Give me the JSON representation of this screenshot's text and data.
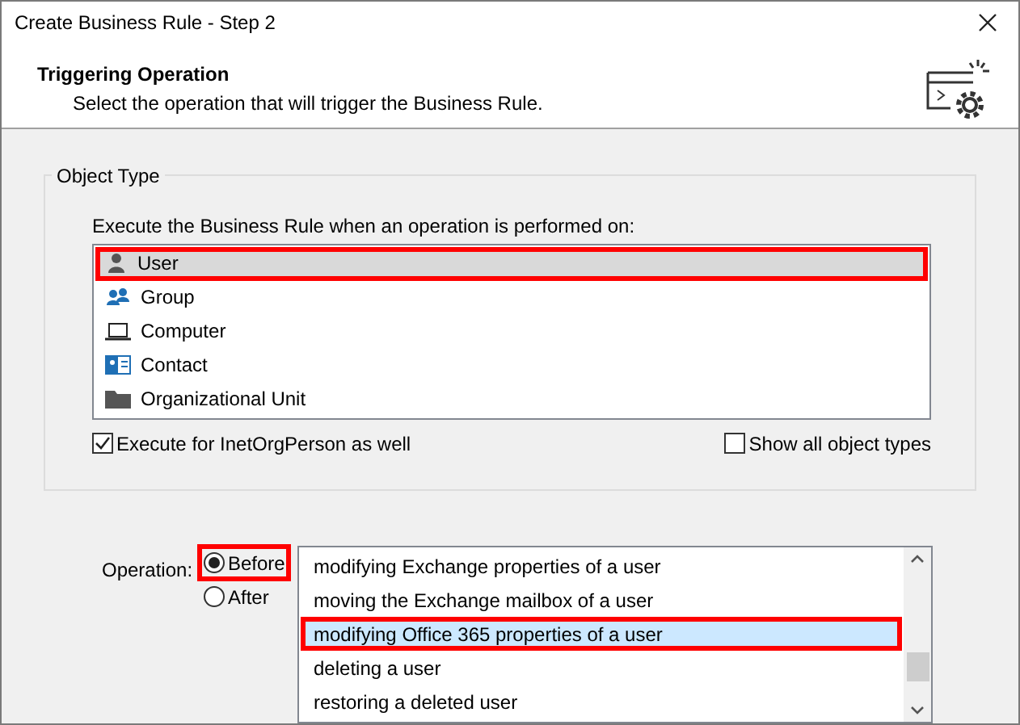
{
  "window": {
    "title": "Create Business Rule - Step 2"
  },
  "header": {
    "title": "Triggering Operation",
    "subtitle": "Select the operation that will trigger the Business Rule."
  },
  "object_type": {
    "group_title": "Object Type",
    "prompt": "Execute the Business Rule when an operation is performed on:",
    "items": [
      {
        "kind": "user",
        "label": "User",
        "selected": true,
        "highlighted": true
      },
      {
        "kind": "group",
        "label": "Group",
        "selected": false,
        "highlighted": false
      },
      {
        "kind": "computer",
        "label": "Computer",
        "selected": false,
        "highlighted": false
      },
      {
        "kind": "contact",
        "label": "Contact",
        "selected": false,
        "highlighted": false
      },
      {
        "kind": "folder",
        "label": "Organizational Unit",
        "selected": false,
        "highlighted": false
      }
    ],
    "checkboxes": [
      {
        "label": "Execute for InetOrgPerson as well",
        "checked": true
      },
      {
        "label": "Show all object types",
        "checked": false
      }
    ]
  },
  "operation": {
    "label": "Operation:",
    "timing": [
      {
        "label": "Before",
        "selected": true,
        "highlighted": true
      },
      {
        "label": "After",
        "selected": false,
        "highlighted": false
      }
    ],
    "items": [
      {
        "label": "modifying Exchange properties of a user",
        "selected": false,
        "highlighted": false
      },
      {
        "label": "moving the Exchange mailbox of a user",
        "selected": false,
        "highlighted": false
      },
      {
        "label": "modifying Office 365 properties of a user",
        "selected": true,
        "highlighted": true
      },
      {
        "label": "deleting a user",
        "selected": false,
        "highlighted": false
      },
      {
        "label": "restoring a deleted user",
        "selected": false,
        "highlighted": false
      }
    ]
  }
}
